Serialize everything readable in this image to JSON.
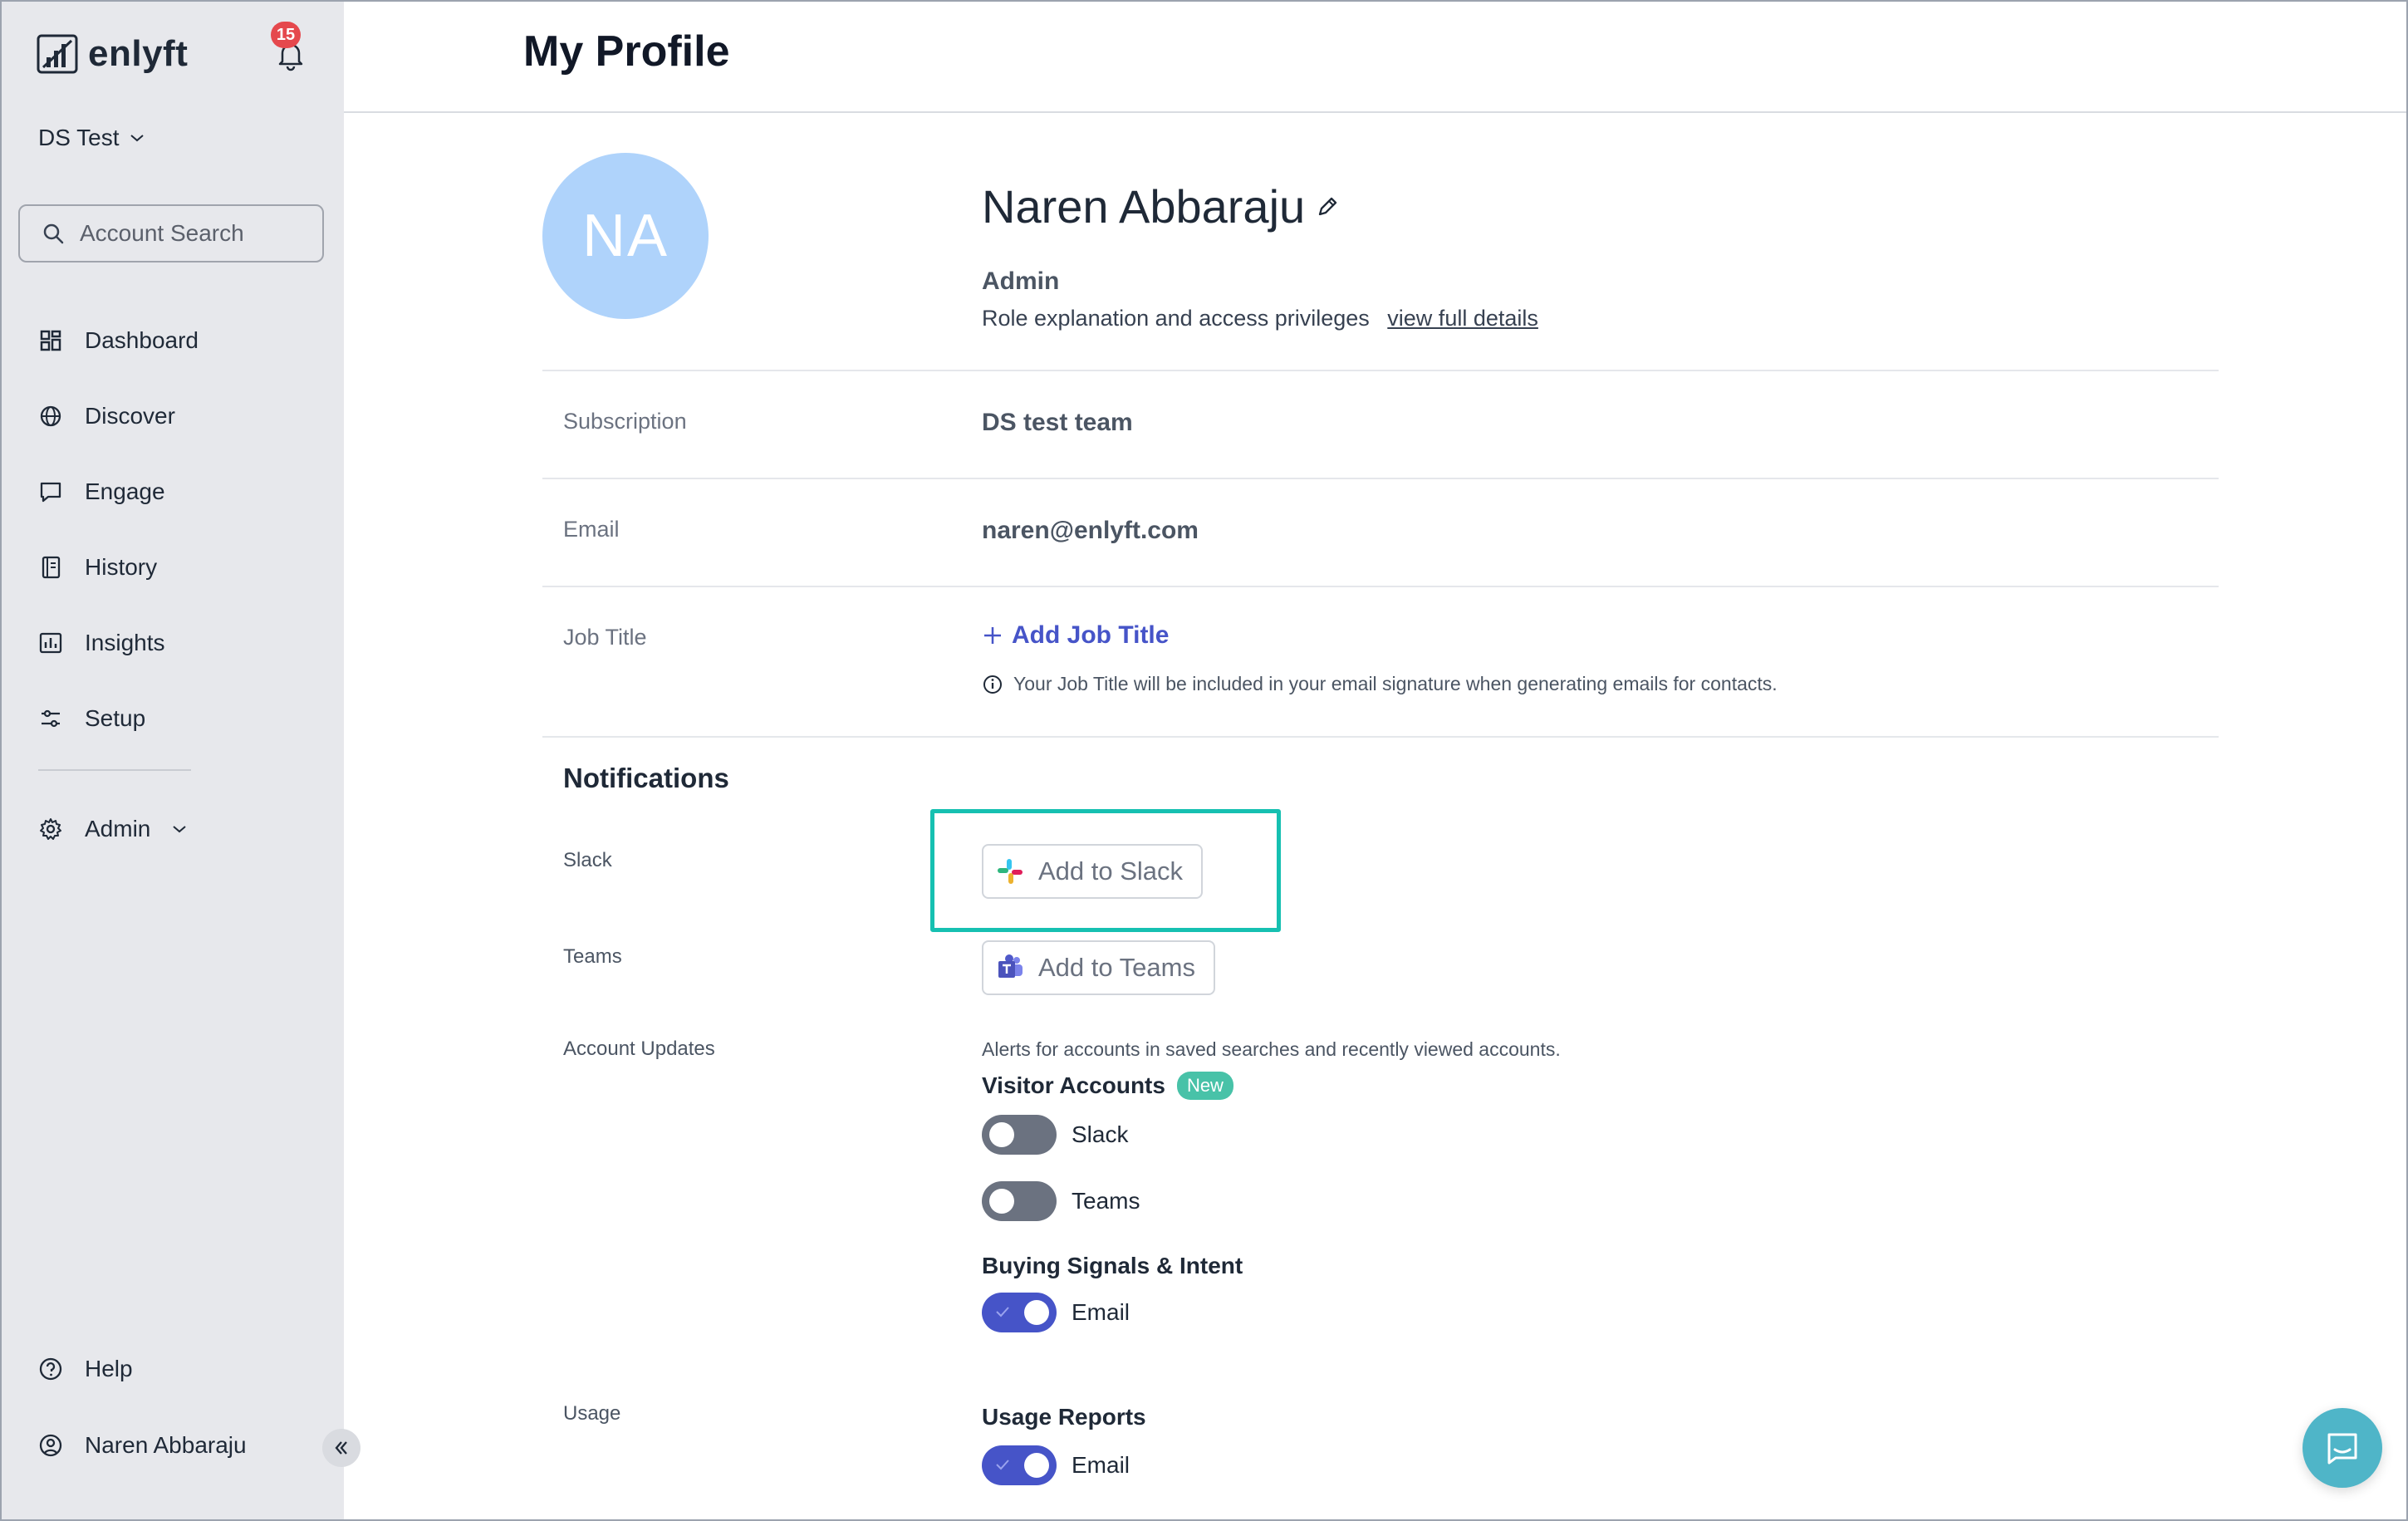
{
  "app": {
    "logo_text": "enlyft",
    "notification_count": "15",
    "workspace": "DS Test"
  },
  "search": {
    "placeholder": "Account Search"
  },
  "nav": {
    "items": [
      {
        "label": "Dashboard",
        "icon": "dashboard-icon"
      },
      {
        "label": "Discover",
        "icon": "globe-icon"
      },
      {
        "label": "Engage",
        "icon": "chat-icon"
      },
      {
        "label": "History",
        "icon": "history-icon"
      },
      {
        "label": "Insights",
        "icon": "chart-icon"
      },
      {
        "label": "Setup",
        "icon": "sliders-icon"
      }
    ],
    "admin_label": "Admin",
    "help_label": "Help",
    "user_label": "Naren Abbaraju"
  },
  "header": {
    "title": "My Profile"
  },
  "profile": {
    "initials": "NA",
    "name": "Naren Abbaraju",
    "role": "Admin",
    "role_description": "Role explanation and access privileges",
    "role_link": "view full details",
    "subscription_label": "Subscription",
    "subscription_value": "DS test team",
    "email_label": "Email",
    "email_value": "naren@enlyft.com",
    "job_title_label": "Job Title",
    "add_job_title": "Add Job Title",
    "job_title_hint": "Your Job Title will be included in your email signature when generating emails for contacts."
  },
  "notifications": {
    "title": "Notifications",
    "slack_label": "Slack",
    "slack_button": "Add to Slack",
    "teams_label": "Teams",
    "teams_button": "Add to Teams",
    "account_updates_label": "Account Updates",
    "account_updates_desc": "Alerts for accounts in saved searches and recently viewed accounts.",
    "visitor_accounts_title": "Visitor Accounts",
    "new_badge": "New",
    "visitor_toggles": [
      {
        "label": "Slack",
        "on": false
      },
      {
        "label": "Teams",
        "on": false
      }
    ],
    "buying_signals_title": "Buying Signals & Intent",
    "buying_signals_toggle": {
      "label": "Email",
      "on": true
    },
    "usage_label": "Usage",
    "usage_reports_title": "Usage Reports",
    "usage_reports_toggle": {
      "label": "Email",
      "on": true
    }
  },
  "colors": {
    "accent": "#4654c8",
    "highlight": "#16c0b1",
    "avatar": "#afd3fb",
    "badge": "#e5484d",
    "new_badge": "#48c2a8"
  }
}
